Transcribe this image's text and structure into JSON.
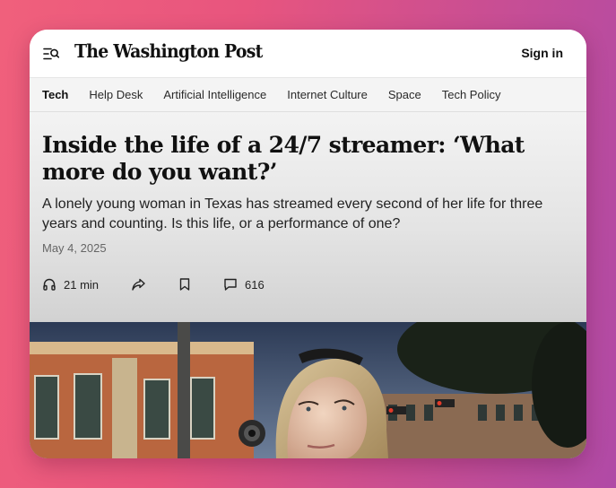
{
  "header": {
    "logo_text": "The Washington Post",
    "sign_in_label": "Sign in"
  },
  "nav": {
    "items": [
      {
        "label": "Tech",
        "active": true
      },
      {
        "label": "Help Desk"
      },
      {
        "label": "Artificial Intelligence"
      },
      {
        "label": "Internet Culture"
      },
      {
        "label": "Space"
      },
      {
        "label": "Tech Policy"
      }
    ]
  },
  "article": {
    "headline": "Inside the life of a 24/7 streamer: ‘What more do you want?’",
    "dek": "A lonely young woman in Texas has streamed every second of her life for three years and counting. Is this life, or a performance of one?",
    "date": "May 4, 2025",
    "listen_duration": "21 min",
    "comment_count": "616"
  },
  "icons": {
    "menu": "menu-search-icon",
    "listen": "headphones-icon",
    "share": "share-icon",
    "save": "bookmark-icon",
    "comments": "comment-icon"
  },
  "colors": {
    "background_start": "#f0607c",
    "background_end": "#b04aa6",
    "text": "#111111"
  }
}
